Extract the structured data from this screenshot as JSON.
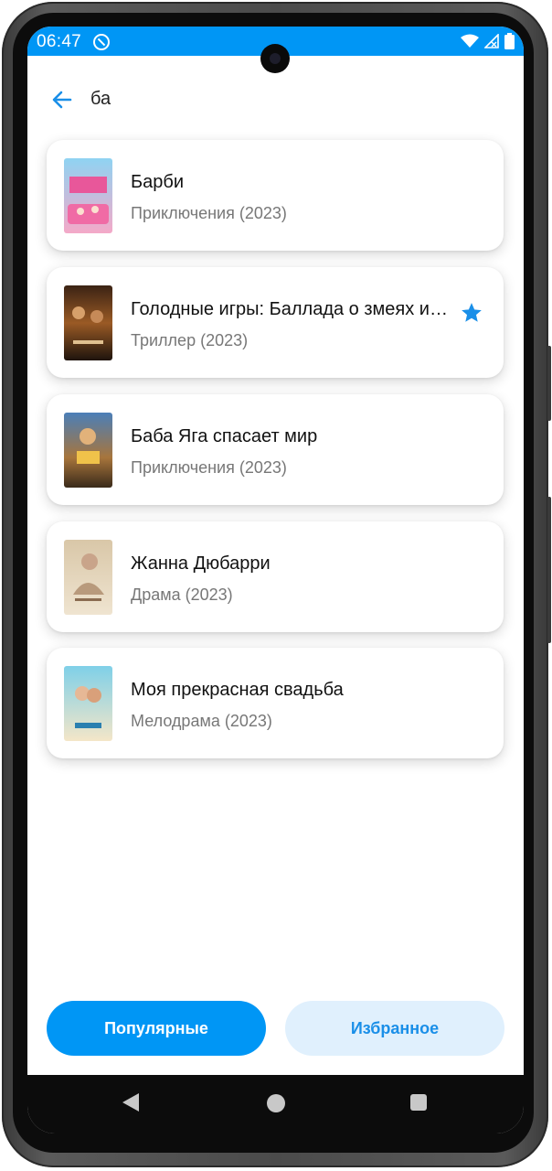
{
  "status": {
    "time": "06:47",
    "icons": [
      "notification-app-icon",
      "wifi-icon",
      "signal-icon",
      "battery-icon"
    ]
  },
  "search": {
    "query": "ба"
  },
  "movies": [
    {
      "title": "Барби",
      "subtitle": "Приключения (2023)",
      "favorite": false,
      "poster": "barbie-poster"
    },
    {
      "title": "Голодные игры: Баллада о змеях и певчих птицах",
      "subtitle": "Триллер (2023)",
      "favorite": true,
      "poster": "hunger-games-poster"
    },
    {
      "title": "Баба Яга спасает мир",
      "subtitle": "Приключения (2023)",
      "favorite": false,
      "poster": "baba-yaga-poster"
    },
    {
      "title": "Жанна Дюбарри",
      "subtitle": "Драма (2023)",
      "favorite": false,
      "poster": "jeanne-du-barry-poster"
    },
    {
      "title": "Моя прекрасная свадьба",
      "subtitle": "Мелодрама (2023)",
      "favorite": false,
      "poster": "wedding-poster"
    }
  ],
  "tabs": {
    "popular_label": "Популярные",
    "favorites_label": "Избранное"
  },
  "colors": {
    "accent": "#0096f5",
    "accent_light": "#e0f0fd",
    "star": "#1a8fe8"
  }
}
